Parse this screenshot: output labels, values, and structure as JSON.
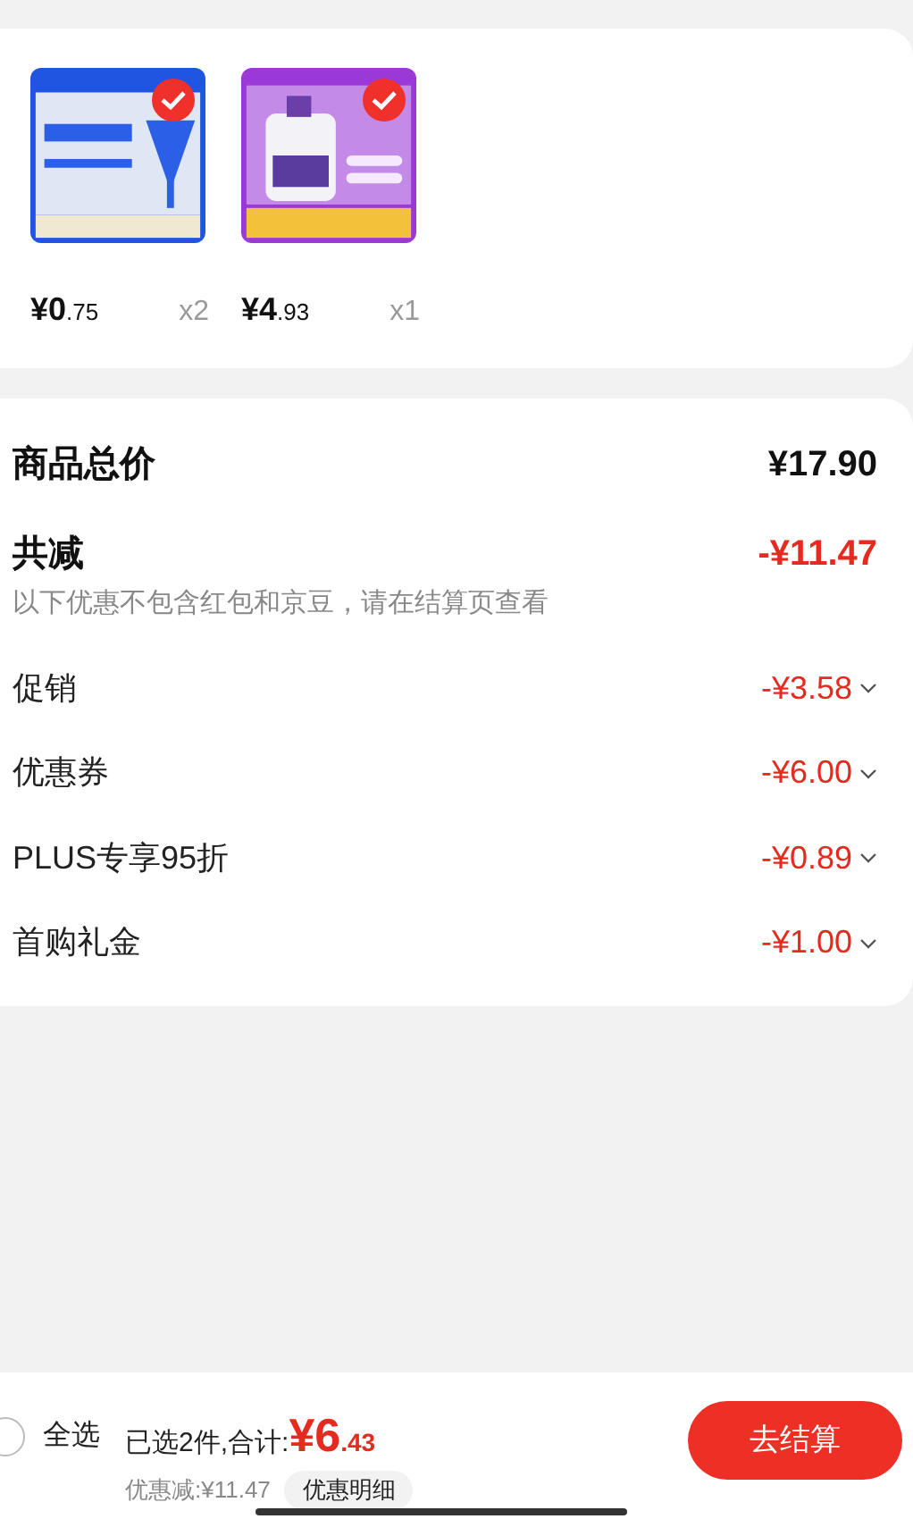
{
  "products": [
    {
      "kind": "picture",
      "selected": true,
      "price_main": "¥0",
      "price_fraction": ".75",
      "quantity": "x2"
    },
    {
      "kind": "picture",
      "selected": true,
      "price_main": "¥4",
      "price_fraction": ".93",
      "quantity": "x1"
    }
  ],
  "summary": {
    "total_label": "商品总价",
    "total_value": "¥17.90",
    "discount_label": "共减",
    "discount_value": "-¥11.47",
    "note": "以下优惠不包含红包和京豆，请在结算页查看",
    "items": [
      {
        "label": "促销",
        "value": "-¥3.58",
        "expanded": false
      },
      {
        "label": "优惠券",
        "value": "-¥6.00",
        "expanded": false
      },
      {
        "label": "PLUS专享95折",
        "value": "-¥0.89",
        "expanded": false
      },
      {
        "label": "首购礼金",
        "value": "-¥1.00",
        "expanded": false
      }
    ]
  },
  "bottom_bar": {
    "select_all": {
      "label": "全选",
      "checked": false
    },
    "selected_text": "已选2件,合计:",
    "total_main": "¥6",
    "total_fraction": ".43",
    "saving": "优惠减:¥11.47",
    "detail_button": "优惠明细",
    "checkout_button": "去结算"
  }
}
